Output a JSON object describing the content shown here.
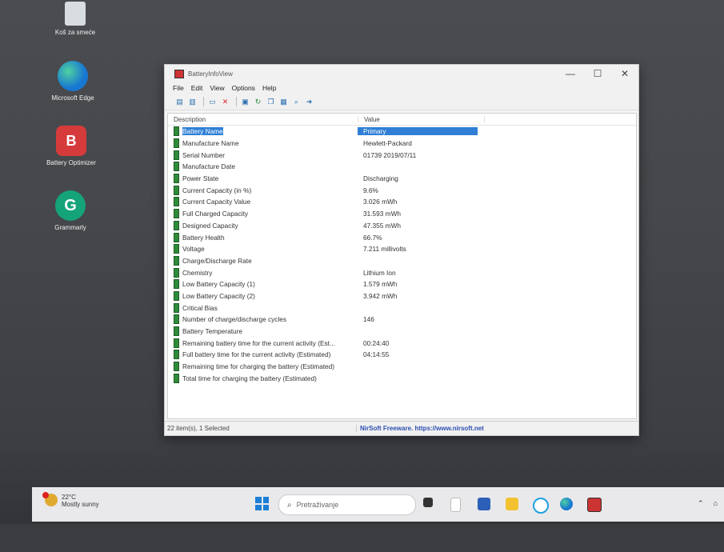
{
  "desktop": {
    "icons": [
      {
        "label": "Koš za smeće",
        "icon": "recycle-bin-icon"
      },
      {
        "label": "Microsoft Edge",
        "icon": "edge-icon"
      },
      {
        "label": "Battery Optimizer",
        "icon": "battery-optimizer-icon"
      },
      {
        "label": "Grammarly",
        "icon": "grammarly-icon"
      }
    ]
  },
  "window": {
    "title": "BatteryInfoView",
    "menu": [
      "File",
      "Edit",
      "View",
      "Options",
      "Help"
    ],
    "columns": {
      "description": "Description",
      "value": "Value"
    },
    "rows": [
      {
        "d": "Battery Name",
        "v": "Primary"
      },
      {
        "d": "Manufacture Name",
        "v": "Hewlett-Packard"
      },
      {
        "d": "Serial Number",
        "v": "01739 2019/07/11"
      },
      {
        "d": "Manufacture Date",
        "v": ""
      },
      {
        "d": "Power State",
        "v": "Discharging"
      },
      {
        "d": "Current Capacity (in %)",
        "v": "9.6%"
      },
      {
        "d": "Current Capacity Value",
        "v": "3.026 mWh"
      },
      {
        "d": "Full Charged Capacity",
        "v": "31.593 mWh"
      },
      {
        "d": "Designed Capacity",
        "v": "47.355 mWh"
      },
      {
        "d": "Battery Health",
        "v": "66.7%"
      },
      {
        "d": "Voltage",
        "v": "7.211 millivolts"
      },
      {
        "d": "Charge/Discharge Rate",
        "v": ""
      },
      {
        "d": "Chemistry",
        "v": "Lithium Ion"
      },
      {
        "d": "Low Battery Capacity (1)",
        "v": "1.579 mWh"
      },
      {
        "d": "Low Battery Capacity (2)",
        "v": "3.942 mWh"
      },
      {
        "d": "Critical Bias",
        "v": ""
      },
      {
        "d": "Number of charge/discharge cycles",
        "v": "146"
      },
      {
        "d": "Battery Temperature",
        "v": ""
      },
      {
        "d": "Remaining battery time for the current activity (Est...",
        "v": "00:24:40"
      },
      {
        "d": "Full battery time for the current activity (Estimated)",
        "v": "04:14:55"
      },
      {
        "d": "Remaining time for charging the battery (Estimated)",
        "v": ""
      },
      {
        "d": "Total  time for charging the battery (Estimated)",
        "v": ""
      }
    ],
    "selected_index": 0,
    "status": {
      "items": "22 item(s), 1 Selected",
      "credit": "NirSoft Freeware. https://www.nirsoft.net"
    }
  },
  "taskbar": {
    "weather": {
      "temp": "22°C",
      "condition": "Mostly sunny"
    },
    "search_placeholder": "Pretraživanje"
  }
}
